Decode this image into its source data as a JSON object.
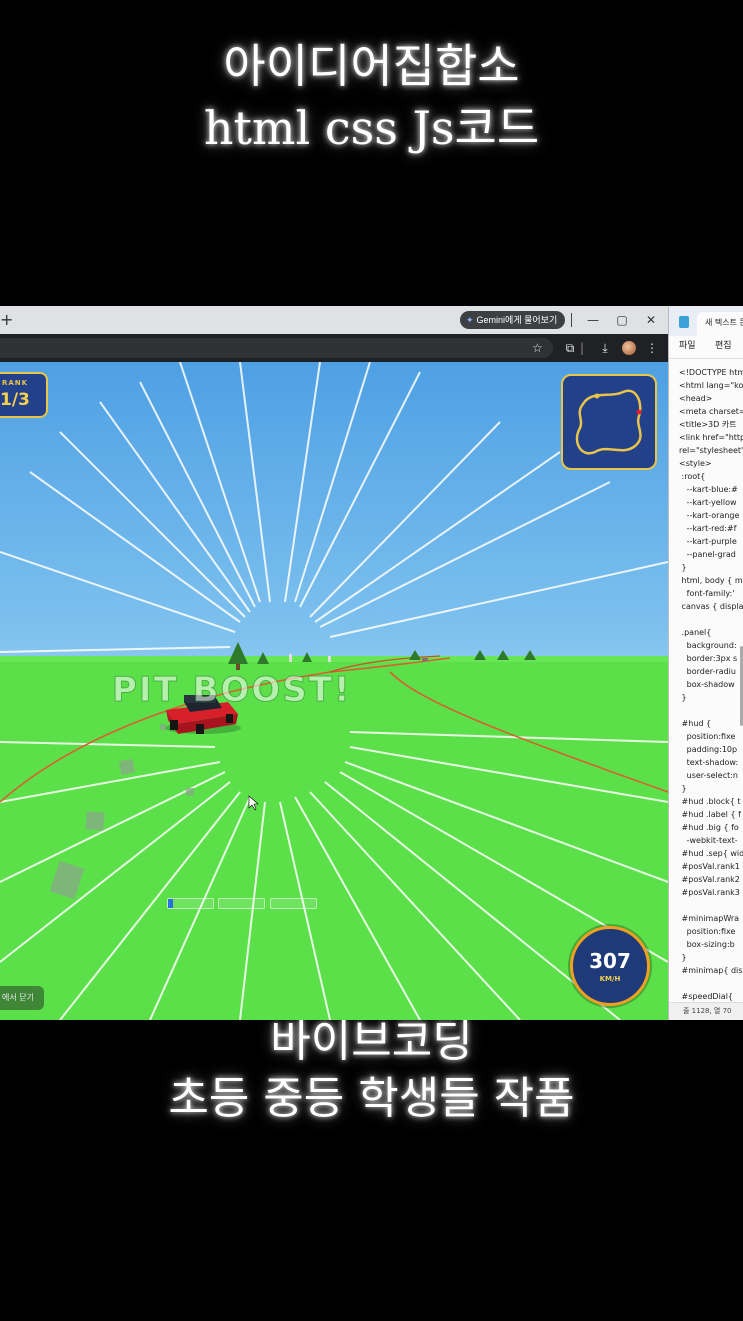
{
  "captions": {
    "top_line1": "아이디어집합소",
    "top_line2": "html css Js코드",
    "bottom_line1": "바이브코딩",
    "bottom_line2": "초등 중등 학생들 작품"
  },
  "browser": {
    "new_tab_label": "+",
    "gemini_button": "Gemini에게 물어보기",
    "window_controls": [
      "—",
      "▢",
      "✕"
    ],
    "toolbar_icons": [
      "star-icon",
      "extensions-icon",
      "download-icon",
      "avatar",
      "menu-icon"
    ]
  },
  "game": {
    "rank_label": "RANK",
    "rank_value": "1/3",
    "boost_text": "PIT BOOST!",
    "speed_value": "307",
    "speed_unit": "KM/H",
    "hint_text": "에서 닫기",
    "progress_segments": [
      {
        "fill": 0.12
      },
      {
        "fill": 0
      },
      {
        "fill": 0
      }
    ],
    "colors": {
      "panel_bg": "#23408a",
      "panel_border": "#e8c44a",
      "kart_red": "#d8202a",
      "grass": "#5ce04a",
      "sky": "#7cc0ee",
      "speed_ring": "#f0a020"
    }
  },
  "notepad": {
    "tab_title": "새 텍스트 문",
    "menu": [
      "파일",
      "편집"
    ],
    "code_lines": [
      "<!DOCTYPE htm",
      "<html lang=\"ko",
      "<head>",
      "<meta charset=",
      "<title>3D 카트",
      "<link href=\"http",
      "rel=\"stylesheet\"",
      "<style>",
      " :root{",
      "   --kart-blue:#",
      "   --kart-yellow",
      "   --kart-orange",
      "   --kart-red:#f",
      "   --kart-purple",
      "   --panel-grad",
      " }",
      " html, body { m",
      "   font-family:'",
      " canvas { displa",
      "",
      " .panel{",
      "   background:",
      "   border:3px s",
      "   border-radiu",
      "   box-shadow",
      " }",
      "",
      " #hud {",
      "   position:fixe",
      "   padding:10p",
      "   text-shadow:",
      "   user-select:n",
      " }",
      " #hud .block{ t",
      " #hud .label { f",
      " #hud .big { fo",
      "   -webkit-text-",
      " #hud .sep{ wid",
      " #posVal.rank1",
      " #posVal.rank2",
      " #posVal.rank3",
      "",
      " #minimapWra",
      "   position:fixe",
      "   box-sizing:b",
      " }",
      " #minimap{ dis",
      "",
      " #speedDial{"
    ],
    "status": "줄 1128, 열 70"
  }
}
